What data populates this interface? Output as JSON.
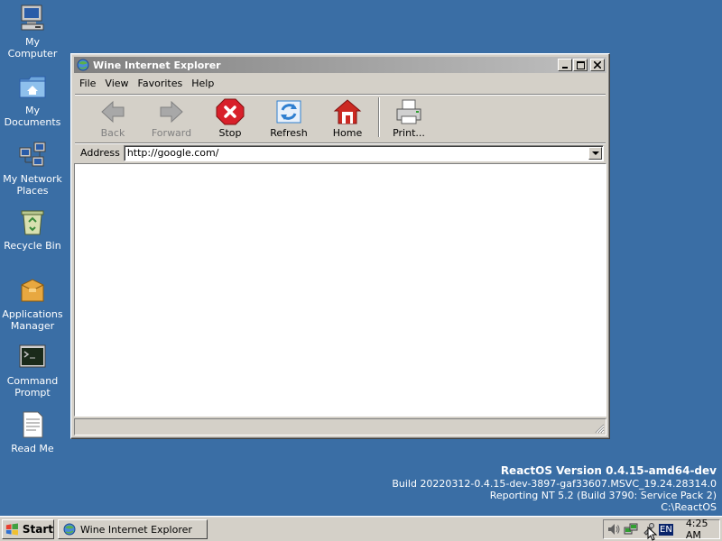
{
  "desktop": {
    "icons": [
      {
        "label_line1": "My",
        "label_line2": "Computer"
      },
      {
        "label_line1": "My",
        "label_line2": "Documents"
      },
      {
        "label_line1": "My Network",
        "label_line2": "Places"
      },
      {
        "label_line1": "Recycle Bin",
        "label_line2": ""
      },
      {
        "label_line1": "Applications",
        "label_line2": "Manager"
      },
      {
        "label_line1": "Command",
        "label_line2": "Prompt"
      },
      {
        "label_line1": "Read Me",
        "label_line2": ""
      }
    ]
  },
  "window": {
    "title": "Wine Internet Explorer",
    "menu": [
      "File",
      "View",
      "Favorites",
      "Help"
    ],
    "toolbar": {
      "back": "Back",
      "forward": "Forward",
      "stop": "Stop",
      "refresh": "Refresh",
      "home": "Home",
      "print": "Print..."
    },
    "address": {
      "label": "Address",
      "value": "http://google.com/"
    }
  },
  "build_info": {
    "version": "ReactOS Version 0.4.15-amd64-dev",
    "build": "Build 20220312-0.4.15-dev-3897-gaf33607.MSVC_19.24.28314.0",
    "reporting": "Reporting NT 5.2 (Build 3790: Service Pack 2)",
    "path": "C:\\ReactOS"
  },
  "taskbar": {
    "start_label": "Start",
    "task_title": "Wine Internet Explorer",
    "language": "EN",
    "clock": "4:25 AM"
  },
  "colors": {
    "desktop": "#3a6ea5",
    "chrome": "#d4d0c8",
    "title_active_start": "#808080",
    "stop_red": "#d8202a",
    "refresh_blue": "#2f7fd0",
    "home_red": "#cc2a22"
  }
}
